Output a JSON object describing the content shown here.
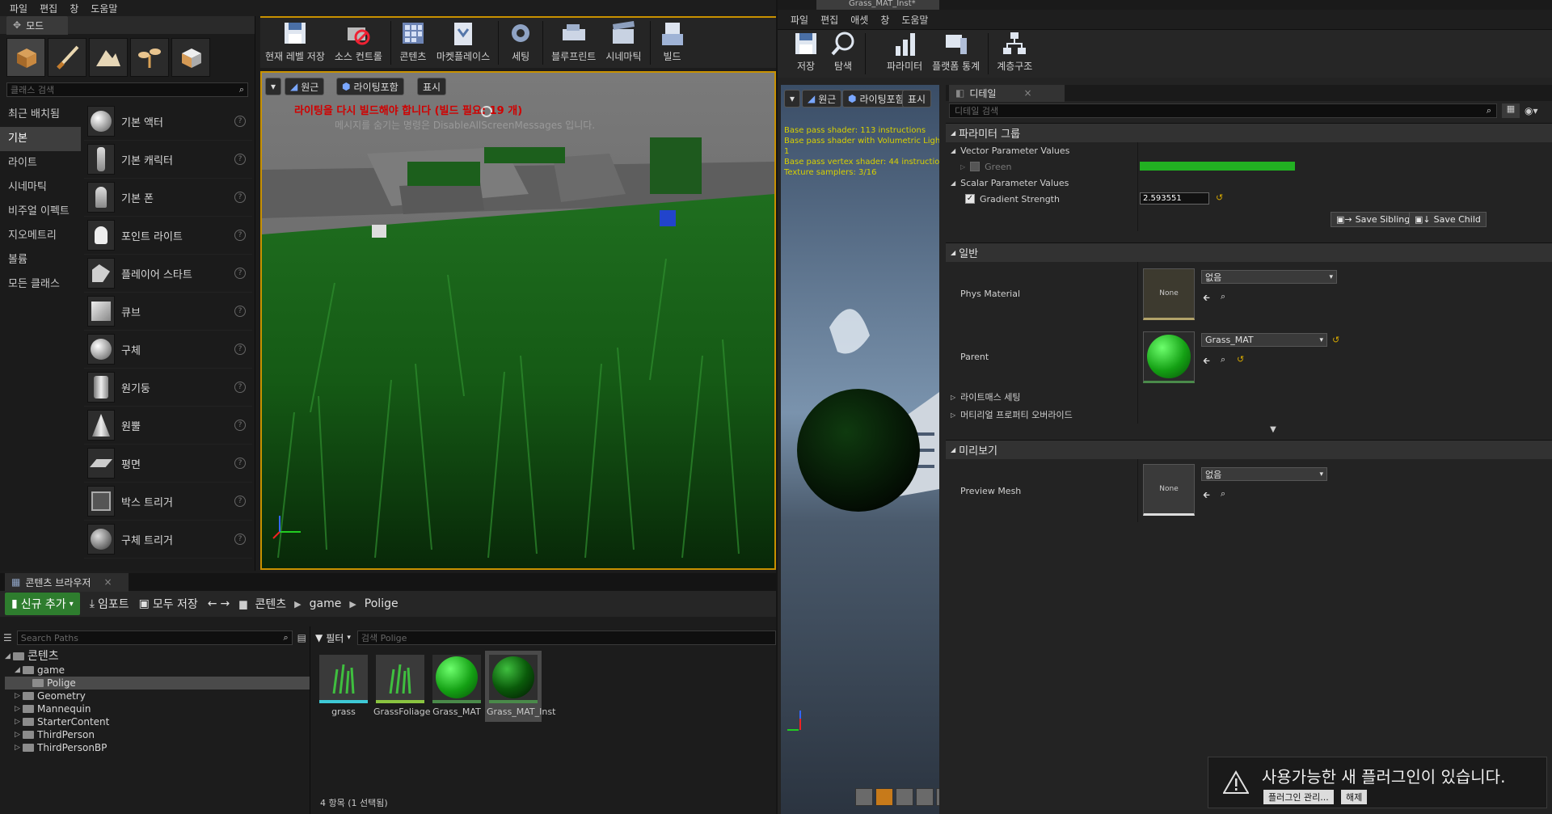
{
  "left_editor": {
    "menu": [
      "파일",
      "편집",
      "창",
      "도움말"
    ],
    "modes": {
      "tab_label": "모드",
      "search_placeholder": "클래스 검색",
      "categories": [
        "최근 배치됨",
        "기본",
        "라이트",
        "시네마틱",
        "비주얼 이펙트",
        "지오메트리",
        "볼륨",
        "모든 클래스"
      ],
      "active_category": "기본",
      "items": [
        "기본 액터",
        "기본 캐릭터",
        "기본 폰",
        "포인트 라이트",
        "플레이어 스타트",
        "큐브",
        "구체",
        "원기둥",
        "원뿔",
        "평면",
        "박스 트리거",
        "구체 트리거"
      ],
      "help_glyph": "?"
    },
    "toolbar": {
      "buttons": [
        "현재 레벨 저장",
        "소스 컨트롤",
        "콘텐츠",
        "마켓플레이스",
        "세팅",
        "블루프린트",
        "시네마틱",
        "빌드"
      ]
    },
    "viewport": {
      "perspective_label": "원근",
      "lighting_label": "라이팅포함",
      "show_label": "표시",
      "warning": "라이팅을 다시 빌드해야 합니다 (빌드 필요: 19 개)",
      "message": "메시지를 숨기는 명령은 DisableAllScreenMessages 입니다."
    },
    "content_browser": {
      "tab_label": "콘텐츠 브라우저",
      "add_new": "신규 추가",
      "import": "임포트",
      "save_all": "모두 저장",
      "breadcrumb": [
        "콘텐츠",
        "game",
        "Polige"
      ],
      "search_paths_placeholder": "Search Paths",
      "filter_label": "필터",
      "search_assets_placeholder": "검색 Polige",
      "tree": [
        {
          "label": "콘텐츠",
          "level": 0
        },
        {
          "label": "game",
          "level": 1
        },
        {
          "label": "Polige",
          "level": 2,
          "selected": true
        },
        {
          "label": "Geometry",
          "level": 1
        },
        {
          "label": "Mannequin",
          "level": 1
        },
        {
          "label": "StarterContent",
          "level": 1
        },
        {
          "label": "ThirdPerson",
          "level": 1
        },
        {
          "label": "ThirdPersonBP",
          "level": 1
        }
      ],
      "assets": [
        {
          "name": "grass",
          "kind": "grass"
        },
        {
          "name": "GrassFoliage",
          "kind": "grass"
        },
        {
          "name": "Grass_MAT",
          "kind": "sphere-bright"
        },
        {
          "name": "Grass_MAT_Inst",
          "kind": "sphere-dark"
        }
      ],
      "status": "4 항목 (1 선택됨)"
    }
  },
  "right_editor": {
    "window_title": "Grass_MAT_Inst*",
    "menu": [
      "파일",
      "편집",
      "애셋",
      "창",
      "도움말"
    ],
    "toolbar": [
      "저장",
      "탐색",
      "파라미터",
      "플랫폼 통계",
      "계층구조"
    ],
    "preview": {
      "perspective_label": "원근",
      "lighting_label": "라이팅포함",
      "show_label": "표시",
      "stats": [
        "Base pass shader: 113 instructions",
        "Base pass shader with Volumetric Lightmap: 1",
        "Base pass vertex shader: 44 instructions",
        "Texture samplers: 3/16"
      ]
    },
    "details": {
      "tab_label": "디테일",
      "search_placeholder": "디테일 검색",
      "param_group_title": "파라미터 그룹",
      "vector_params_title": "Vector Parameter Values",
      "vector_param_name": "Green",
      "vector_param_color": "#22b022",
      "scalar_params_title": "Scalar Parameter Values",
      "scalar_param_name": "Gradient Strength",
      "scalar_param_value": "2.593551",
      "save_sibling": "Save Sibling",
      "save_child": "Save Child",
      "general_title": "일반",
      "phys_material_label": "Phys Material",
      "phys_material_value": "없음",
      "none_thumb": "None",
      "parent_label": "Parent",
      "parent_value": "Grass_MAT",
      "lightmass_label": "라이트매스 세팅",
      "material_override_label": "머티리얼 프로퍼티 오버라이드",
      "preview_title": "미리보기",
      "preview_mesh_label": "Preview Mesh",
      "preview_mesh_value": "없음"
    }
  },
  "notification": {
    "message": "사용가능한 새 플러그인이 있습니다.",
    "manage_button": "플러그인 관리...",
    "dismiss_button": "해제"
  }
}
